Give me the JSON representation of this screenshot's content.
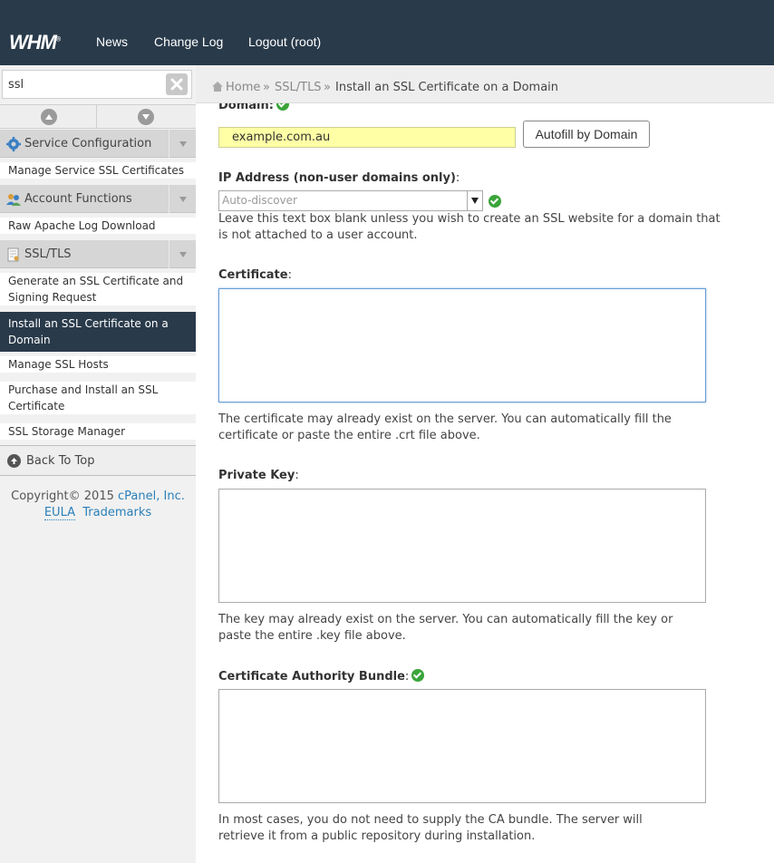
{
  "header": {
    "logo": "WHM",
    "logo_mark": "®",
    "nav": [
      "News",
      "Change Log",
      "Logout (root)"
    ]
  },
  "sidebar": {
    "search_value": "ssl",
    "categories": [
      {
        "label": "Service Configuration",
        "icon": "gear-icon",
        "items": [
          "Manage Service SSL Certificates"
        ]
      },
      {
        "label": "Account Functions",
        "icon": "users-icon",
        "items": [
          "Raw Apache Log Download"
        ]
      },
      {
        "label": "SSL/TLS",
        "icon": "certificate-icon",
        "items": [
          "Generate an SSL Certificate and Signing Request",
          "Install an SSL Certificate on a Domain",
          "Manage SSL Hosts",
          "Purchase and Install an SSL Certificate",
          "SSL Storage Manager"
        ]
      }
    ],
    "active_item": "Install an SSL Certificate on a Domain",
    "back_to_top": "Back To Top",
    "footer": {
      "copyright": "Copyright© 2015",
      "company_link": "cPanel, Inc.",
      "eula": "EULA",
      "trademarks": "Trademarks"
    }
  },
  "breadcrumb": {
    "home": "Home",
    "sep": "»",
    "section": "SSL/TLS",
    "current": "Install an SSL Certificate on a Domain"
  },
  "form": {
    "domain_label": "Domain:",
    "domain_value": "example.com.au",
    "autofill_button": "Autofill by Domain",
    "ip_label": "IP Address (non-user domains only)",
    "ip_colon": ":",
    "ip_placeholder": "Auto-discover",
    "ip_help": "Leave this text box blank unless you wish to create an SSL website for a domain that is not attached to a user account.",
    "cert_label": "Certificate",
    "cert_colon": ":",
    "cert_help": "The certificate may already exist on the server. You can automatically fill the certificate or paste the entire .crt file above.",
    "key_label": "Private Key",
    "key_colon": ":",
    "key_help": "The key may already exist on the server. You can automatically fill the key or paste the entire .key file above.",
    "ca_label": "Certificate Authority Bundle",
    "ca_colon": ":",
    "ca_help": "In most cases, you do not need to supply the CA bundle. The server will retrieve it from a public repository during installation."
  },
  "colors": {
    "topbar": "#293a4a",
    "active_item": "#293a4a",
    "domain_field": "#ffffa6",
    "check": "#3aa53a",
    "link": "#2a7fb8"
  }
}
